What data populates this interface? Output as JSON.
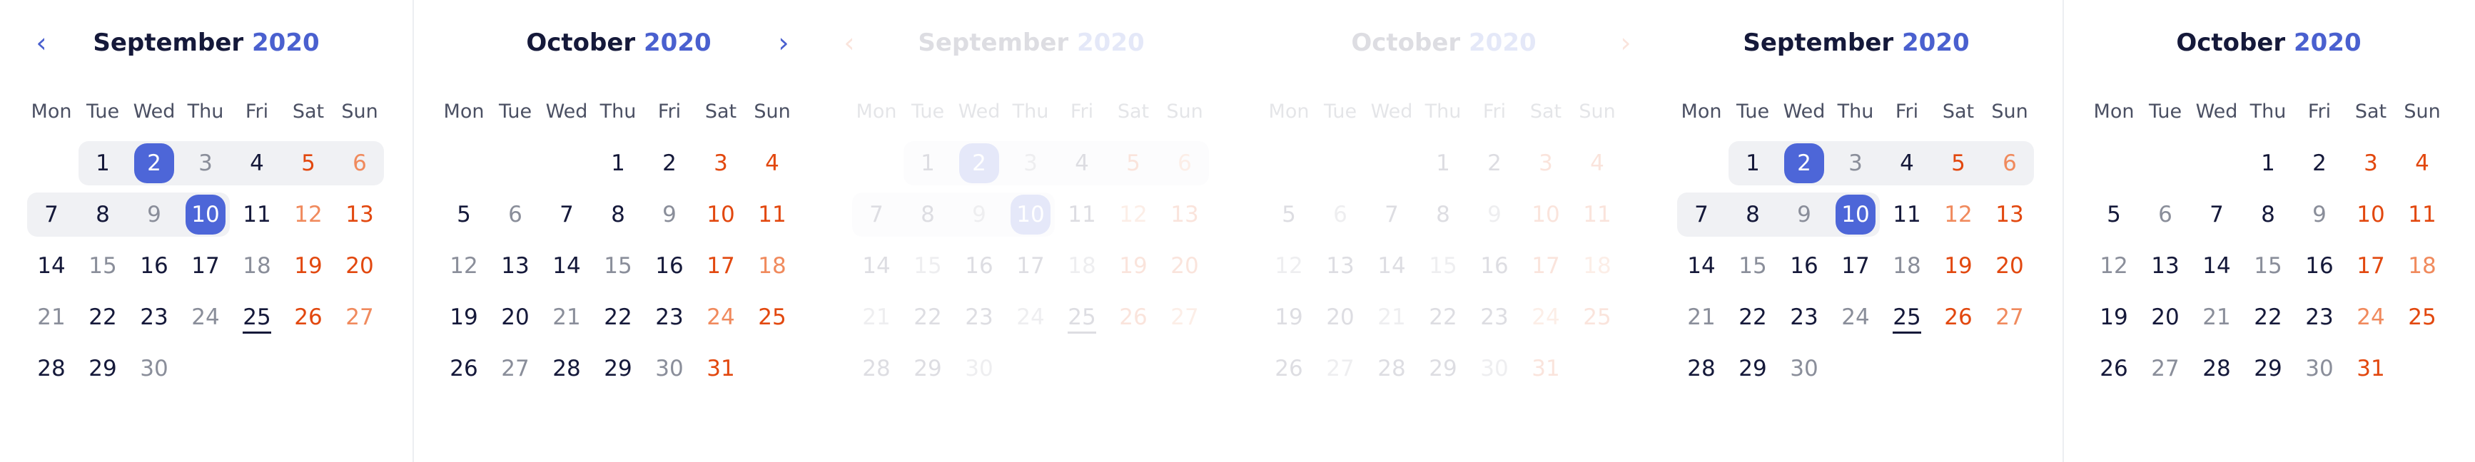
{
  "weekdays": [
    "Mon",
    "Tue",
    "Wed",
    "Thu",
    "Fri",
    "Sat",
    "Sun"
  ],
  "icons": {
    "prev": "chevron-left-icon",
    "next": "chevron-right-icon"
  },
  "colors": {
    "accent": "#4a60cf",
    "weekend": "#e2480f",
    "text": "#15193a"
  },
  "panels": [
    {
      "month": "September",
      "year": "2020",
      "nav": "prev",
      "ghost": false,
      "prev_glyph": "‹",
      "weeks": [
        [
          "",
          "1",
          "2",
          "3",
          "4",
          "5",
          "6"
        ],
        [
          "7",
          "8",
          "9",
          "10",
          "11",
          "12",
          "13"
        ],
        [
          "14",
          "15",
          "16",
          "17",
          "18",
          "19",
          "20"
        ],
        [
          "21",
          "22",
          "23",
          "24",
          "25",
          "26",
          "27"
        ],
        [
          "28",
          "29",
          "30",
          "",
          "",
          "",
          ""
        ]
      ],
      "selected": [
        "2",
        "10"
      ],
      "today": "25"
    },
    {
      "month": "October",
      "year": "2020",
      "nav": "next",
      "ghost": false,
      "next_glyph": "›",
      "weeks": [
        [
          "",
          "",
          "",
          "1",
          "2",
          "3",
          "4"
        ],
        [
          "5",
          "6",
          "7",
          "8",
          "9",
          "10",
          "11"
        ],
        [
          "12",
          "13",
          "14",
          "15",
          "16",
          "17",
          "18"
        ],
        [
          "19",
          "20",
          "21",
          "22",
          "23",
          "24",
          "25"
        ],
        [
          "26",
          "27",
          "28",
          "29",
          "30",
          "31",
          ""
        ]
      ],
      "selected": [],
      "today": ""
    },
    {
      "month": "September",
      "year": "2020",
      "nav": "prev",
      "ghost": true,
      "prev_glyph": "‹",
      "weeks": [
        [
          "",
          "1",
          "2",
          "3",
          "4",
          "5",
          "6"
        ],
        [
          "7",
          "8",
          "9",
          "10",
          "11",
          "12",
          "13"
        ],
        [
          "14",
          "15",
          "16",
          "17",
          "18",
          "19",
          "20"
        ],
        [
          "21",
          "22",
          "23",
          "24",
          "25",
          "26",
          "27"
        ],
        [
          "28",
          "29",
          "30",
          "",
          "",
          "",
          ""
        ]
      ],
      "selected": [
        "2",
        "10"
      ],
      "today": "25"
    },
    {
      "month": "October",
      "year": "2020",
      "nav": "next",
      "ghost": true,
      "next_glyph": "›",
      "weeks": [
        [
          "",
          "",
          "",
          "1",
          "2",
          "3",
          "4"
        ],
        [
          "5",
          "6",
          "7",
          "8",
          "9",
          "10",
          "11"
        ],
        [
          "12",
          "13",
          "14",
          "15",
          "16",
          "17",
          "18"
        ],
        [
          "19",
          "20",
          "21",
          "22",
          "23",
          "24",
          "25"
        ],
        [
          "26",
          "27",
          "28",
          "29",
          "30",
          "31",
          ""
        ]
      ],
      "selected": [],
      "today": ""
    },
    {
      "month": "September",
      "year": "2020",
      "nav": "none",
      "ghost": false,
      "weeks": [
        [
          "",
          "1",
          "2",
          "3",
          "4",
          "5",
          "6"
        ],
        [
          "7",
          "8",
          "9",
          "10",
          "11",
          "12",
          "13"
        ],
        [
          "14",
          "15",
          "16",
          "17",
          "18",
          "19",
          "20"
        ],
        [
          "21",
          "22",
          "23",
          "24",
          "25",
          "26",
          "27"
        ],
        [
          "28",
          "29",
          "30",
          "",
          "",
          "",
          ""
        ]
      ],
      "selected": [
        "2",
        "10"
      ],
      "today": "25"
    },
    {
      "month": "October",
      "year": "2020",
      "nav": "none",
      "ghost": false,
      "weeks": [
        [
          "",
          "",
          "",
          "1",
          "2",
          "3",
          "4"
        ],
        [
          "5",
          "6",
          "7",
          "8",
          "9",
          "10",
          "11"
        ],
        [
          "12",
          "13",
          "14",
          "15",
          "16",
          "17",
          "18"
        ],
        [
          "19",
          "20",
          "21",
          "22",
          "23",
          "24",
          "25"
        ],
        [
          "26",
          "27",
          "28",
          "29",
          "30",
          "31",
          ""
        ]
      ],
      "selected": [],
      "today": ""
    }
  ]
}
